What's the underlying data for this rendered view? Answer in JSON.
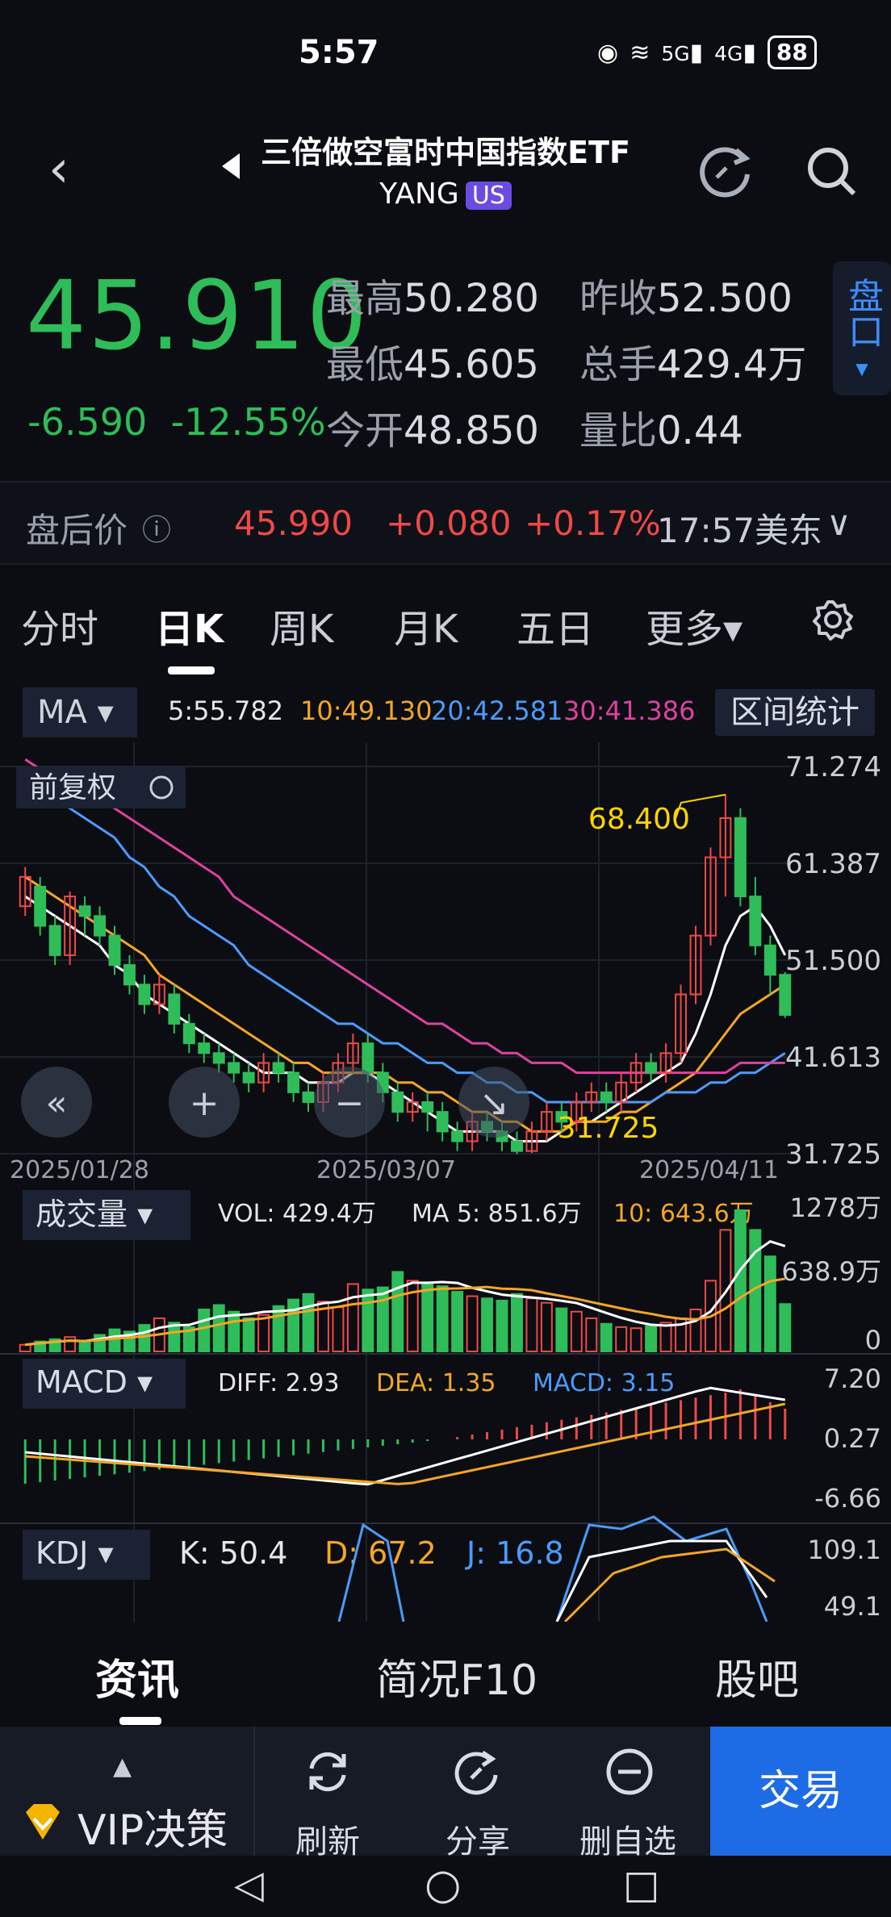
{
  "status": {
    "time": "5:57",
    "net1": "5G",
    "net2": "4G",
    "battery": "88"
  },
  "header": {
    "title": "三倍做空富时中国指数ETF",
    "ticker": "YANG",
    "market": "US"
  },
  "quote": {
    "price": "45.910",
    "change": "-6.590",
    "change_pct": "-12.55%",
    "high_label": "最高",
    "high": "50.280",
    "low_label": "最低",
    "low": "45.605",
    "open_label": "今开",
    "open": "48.850",
    "prev_label": "昨收",
    "prev": "52.500",
    "volume_label": "总手",
    "volume": "429.4万",
    "ratio_label": "量比",
    "ratio": "0.44",
    "pankou_label": "盘口"
  },
  "after_hours": {
    "label": "盘后价",
    "price": "45.990",
    "change": "+0.080",
    "change_pct": "+0.17%",
    "time": "17:57美东"
  },
  "tabs": [
    "分时",
    "日K",
    "周K",
    "月K",
    "五日",
    "更多"
  ],
  "ma": {
    "label": "MA",
    "ma5": "5:55.782",
    "ma10": "10:49.130",
    "ma20": "20:42.581",
    "ma30": "30:41.386",
    "range_stats": "区间统计"
  },
  "chart_data": {
    "type": "candlestick",
    "adjust_label": "前复权",
    "y_ticks": [
      "71.274",
      "61.387",
      "51.500",
      "41.613",
      "31.725"
    ],
    "x_ticks": [
      "2025/01/28",
      "2025/03/07",
      "2025/04/11"
    ],
    "annotations": {
      "high": "68.400",
      "low": "31.725"
    },
    "ylim": [
      31.725,
      71.274
    ],
    "candles": [
      [
        57,
        60,
        56,
        61
      ],
      [
        59,
        55,
        54,
        60
      ],
      [
        55,
        52,
        51,
        56
      ],
      [
        52,
        58,
        51,
        58.5
      ],
      [
        57,
        56,
        54,
        58
      ],
      [
        56,
        54,
        53,
        57
      ],
      [
        54,
        51,
        50,
        55
      ],
      [
        51,
        49,
        48,
        52
      ],
      [
        49,
        47,
        46,
        50
      ],
      [
        47,
        49,
        46,
        50
      ],
      [
        48,
        45,
        44,
        49
      ],
      [
        45,
        43,
        42,
        46
      ],
      [
        43,
        42,
        41,
        44
      ],
      [
        42,
        41,
        40,
        43
      ],
      [
        41,
        40,
        39,
        42
      ],
      [
        40,
        39,
        38,
        41
      ],
      [
        39,
        41,
        38,
        42
      ],
      [
        41,
        40,
        39,
        42
      ],
      [
        40,
        38,
        37,
        41
      ],
      [
        38,
        37,
        36,
        39
      ],
      [
        37,
        39,
        36,
        40
      ],
      [
        39,
        41,
        38,
        42
      ],
      [
        41,
        43,
        40,
        44
      ],
      [
        43,
        40,
        39,
        44
      ],
      [
        40,
        38,
        37,
        41
      ],
      [
        38,
        36,
        35,
        39
      ],
      [
        36,
        37,
        35,
        38
      ],
      [
        37,
        36,
        34,
        38
      ],
      [
        36,
        34,
        33,
        37
      ],
      [
        34,
        33,
        32,
        35
      ],
      [
        33,
        35,
        32,
        36
      ],
      [
        35,
        34,
        33,
        36
      ],
      [
        34,
        33,
        32,
        35
      ],
      [
        33,
        32,
        31.7,
        34
      ],
      [
        32,
        34,
        31.8,
        35
      ],
      [
        34,
        36,
        33,
        37
      ],
      [
        36,
        35,
        34,
        37
      ],
      [
        35,
        37,
        34,
        38
      ],
      [
        37,
        38,
        36,
        39
      ],
      [
        38,
        37,
        36,
        39
      ],
      [
        37,
        39,
        36,
        40
      ],
      [
        39,
        41,
        38,
        42
      ],
      [
        41,
        40,
        39,
        42
      ],
      [
        40,
        42,
        39,
        43
      ],
      [
        42,
        48,
        41,
        49
      ],
      [
        48,
        54,
        47,
        55
      ],
      [
        54,
        62,
        53,
        63
      ],
      [
        62,
        66,
        58,
        68.4
      ],
      [
        66,
        58,
        57,
        67
      ],
      [
        58,
        53,
        52,
        60
      ],
      [
        53,
        50,
        48,
        54
      ],
      [
        50,
        45.9,
        45.6,
        50.28
      ]
    ],
    "ma_lines": {
      "ma5": [
        58,
        57,
        56,
        55,
        54,
        53,
        51,
        50,
        48,
        47,
        46,
        45,
        44,
        43,
        42,
        41,
        40,
        40,
        40,
        39,
        39,
        39,
        40,
        40,
        39,
        38,
        37,
        36,
        35,
        34,
        34,
        34,
        34,
        33,
        33,
        33,
        34,
        35,
        35,
        36,
        37,
        38,
        39,
        40,
        41,
        44,
        48,
        53,
        56,
        57,
        55,
        52
      ],
      "ma10": [
        60,
        59,
        58,
        57,
        56,
        55,
        54,
        53,
        52,
        50,
        49,
        48,
        47,
        46,
        45,
        44,
        43,
        42,
        41,
        41,
        40,
        40,
        40,
        40,
        40,
        39,
        39,
        38,
        38,
        37,
        36,
        36,
        35,
        35,
        34,
        34,
        34,
        35,
        35,
        35,
        36,
        36,
        37,
        38,
        39,
        40,
        42,
        44,
        46,
        47,
        48,
        49
      ],
      "ma20": [
        70,
        69,
        68,
        67,
        66,
        65,
        64,
        62,
        61,
        59,
        58,
        56,
        55,
        54,
        53,
        51,
        50,
        49,
        48,
        47,
        46,
        45,
        45,
        44,
        43,
        43,
        42,
        41,
        41,
        40,
        40,
        39,
        39,
        38,
        38,
        37,
        37,
        37,
        37,
        37,
        37,
        37,
        37,
        38,
        38,
        38,
        39,
        39,
        40,
        40,
        41,
        42
      ],
      "ma30": [
        72,
        71,
        70,
        70,
        69,
        68,
        67,
        66,
        65,
        64,
        63,
        62,
        61,
        60,
        58,
        57,
        56,
        55,
        54,
        53,
        52,
        51,
        50,
        49,
        48,
        47,
        46,
        45,
        45,
        44,
        43,
        43,
        42,
        42,
        41,
        41,
        41,
        40,
        40,
        40,
        40,
        40,
        40,
        40,
        40,
        40,
        40,
        40,
        41,
        41,
        41,
        41
      ]
    },
    "volume": {
      "label": "成交量",
      "vol": "VOL: 429.4万",
      "ma5": "MA 5: 851.6万",
      "ma10": "10: 643.6万",
      "y_ticks": [
        "1278万",
        "638.9万",
        "0"
      ],
      "values": [
        60,
        90,
        110,
        130,
        80,
        150,
        200,
        180,
        240,
        300,
        260,
        220,
        380,
        420,
        360,
        300,
        330,
        410,
        470,
        520,
        450,
        400,
        610,
        560,
        580,
        720,
        640,
        610,
        590,
        540,
        500,
        480,
        460,
        520,
        480,
        440,
        390,
        360,
        300,
        250,
        220,
        210,
        230,
        260,
        300,
        380,
        640,
        1100,
        1278,
        1100,
        860,
        429
      ]
    },
    "macd": {
      "label": "MACD",
      "diff": "DIFF: 2.93",
      "dea": "DEA: 1.35",
      "macd": "MACD: 3.15",
      "y_ticks": [
        "7.20",
        "0.27",
        "-6.66"
      ]
    },
    "kdj": {
      "label": "KDJ",
      "k": "K: 50.4",
      "d": "D: 67.2",
      "j": "J: 16.8",
      "y_ticks": [
        "109.1",
        "49.1"
      ]
    }
  },
  "bottom_tabs": [
    "资讯",
    "简况F10",
    "股吧"
  ],
  "toolbar": {
    "vip": "VIP决策",
    "refresh": "刷新",
    "share": "分享",
    "remove": "删自选",
    "trade": "交易"
  }
}
